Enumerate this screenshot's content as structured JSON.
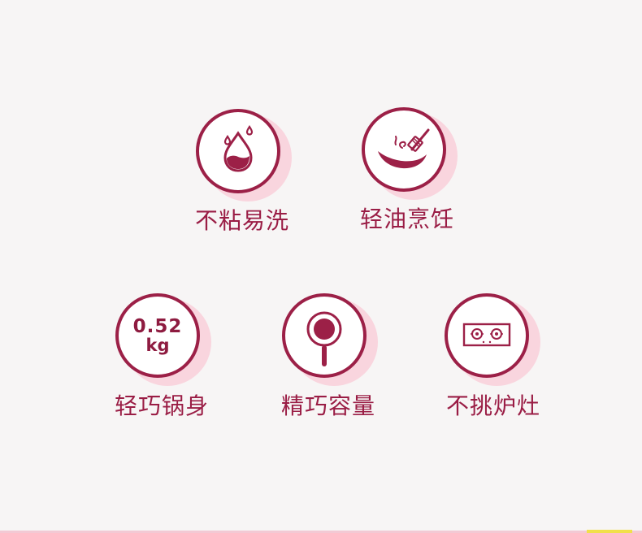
{
  "features": [
    {
      "label": "不粘易洗",
      "icon": "oil-drop-icon"
    },
    {
      "label": "轻油烹饪",
      "icon": "wok-spatula-icon"
    },
    {
      "label": "轻巧锅身",
      "icon": "weight-text-icon",
      "weight_value": "0.52",
      "weight_unit": "kg"
    },
    {
      "label": "精巧容量",
      "icon": "frying-pan-icon"
    },
    {
      "label": "不挑炉灶",
      "icon": "gas-stove-icon"
    }
  ],
  "colors": {
    "accent": "#9c2047",
    "badge_shadow": "#f9d5de",
    "background": "#f7f5f5"
  }
}
